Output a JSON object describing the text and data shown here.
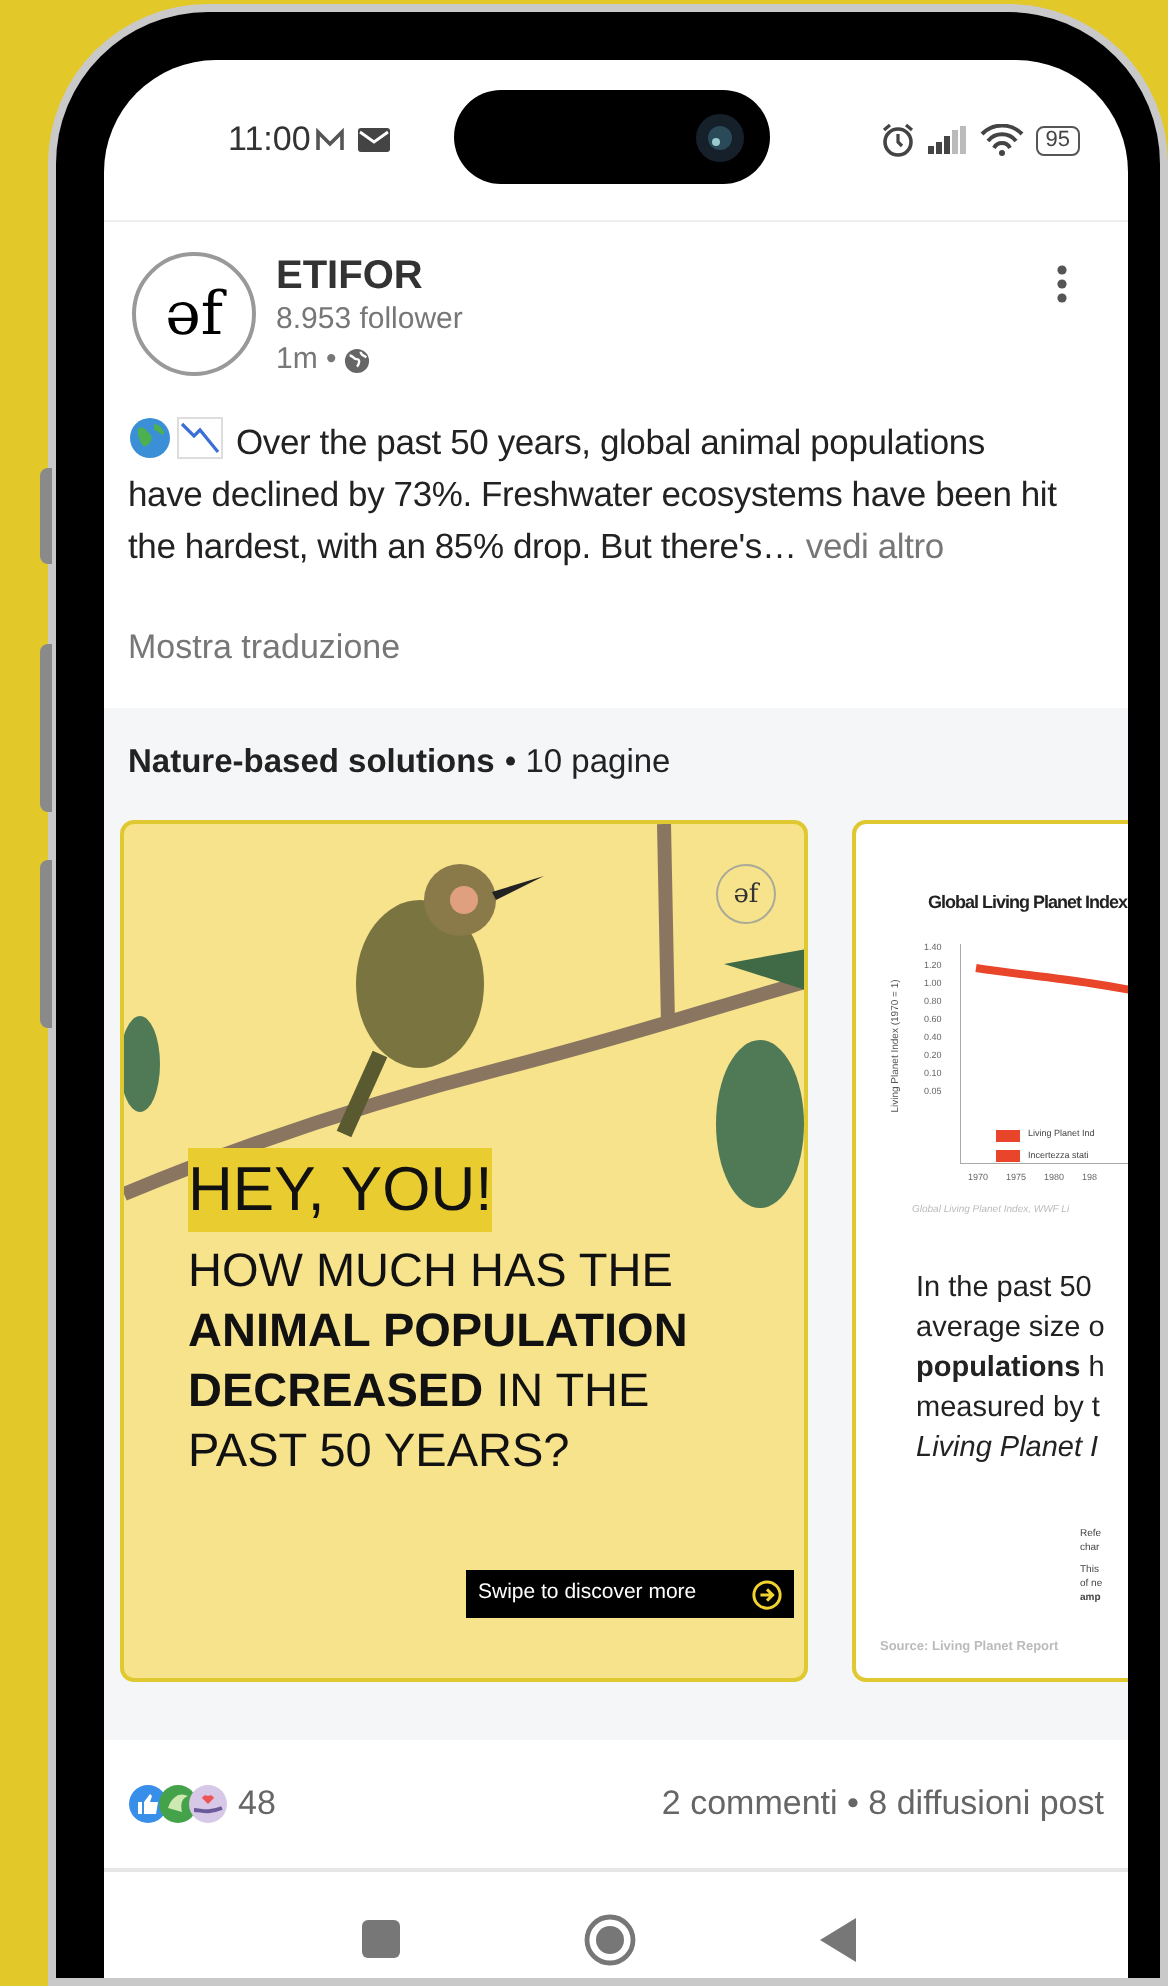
{
  "status_bar": {
    "time": "11:00",
    "battery": "95"
  },
  "post": {
    "avatar_logo": "əf",
    "author": "ETIFOR",
    "followers": "8.953 follower",
    "age": "1m •",
    "text": "Over the past 50 years, global animal populations have declined by 73%. Freshwater ecosystems have been hit the hardest, with an 85% drop. But there's…",
    "see_more": "vedi altro",
    "translate": "Mostra traduzione"
  },
  "document": {
    "title": "Nature-based solutions",
    "pages": "• 10 pagine",
    "slides": [
      {
        "kind": "cover",
        "logo": "əf",
        "heading": "HEY, YOU!",
        "question": "HOW MUCH HAS THE **ANIMAL POPULATION DECREASED** IN THE PAST 50 YEARS?",
        "button": "Swipe to discover more"
      },
      {
        "kind": "chart",
        "title": "Global Living Planet Index",
        "ylabel": "Living Planet Index (1970 = 1)",
        "yticks": [
          "1.40",
          "1.20",
          "1.00",
          "0.80",
          "0.60",
          "0.40",
          "0.20",
          "0.10",
          "0.05"
        ],
        "xticks": [
          "1970",
          "1975",
          "1980",
          "198"
        ],
        "legend": [
          "Living Planet Ind",
          "Incertezza stati"
        ],
        "caption": "Global Living Planet Index, WWF Li",
        "lines": [
          {
            "text": "In the past 50",
            "italic": false
          },
          {
            "text": "average size o",
            "italic": false
          },
          {
            "text": "**populations** h",
            "italic": false
          },
          {
            "text": "measured by t",
            "italic": false
          },
          {
            "text": "Living Planet I",
            "italic": true
          }
        ],
        "notes": [
          "Refe",
          "char",
          "This",
          "of ne",
          "**amp**"
        ],
        "source": "Source: Living Planet Report"
      }
    ]
  },
  "footer": {
    "reactions": "48",
    "stats": "2 commenti • 8 diffusioni post"
  }
}
